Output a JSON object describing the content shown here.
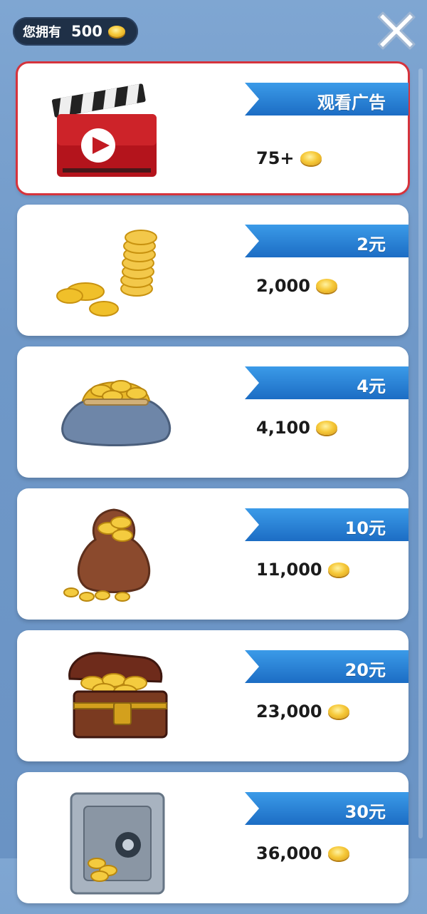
{
  "header": {
    "balance_label": "您拥有",
    "balance_value": "500"
  },
  "items": [
    {
      "price_label": "观看广告",
      "reward": "75+",
      "icon": "video-clapperboard-icon"
    },
    {
      "price_label": "2元",
      "reward": "2,000",
      "icon": "coin-stack-icon"
    },
    {
      "price_label": "4元",
      "reward": "4,100",
      "icon": "coin-purse-icon"
    },
    {
      "price_label": "10元",
      "reward": "11,000",
      "icon": "coin-sack-icon"
    },
    {
      "price_label": "20元",
      "reward": "23,000",
      "icon": "treasure-chest-icon"
    },
    {
      "price_label": "30元",
      "reward": "36,000",
      "icon": "safe-icon"
    }
  ],
  "colors": {
    "background": "#6f98c8",
    "ribbon": "#1c6dc4",
    "selected_outline": "#d6333c",
    "coin": "#f6c93a"
  }
}
